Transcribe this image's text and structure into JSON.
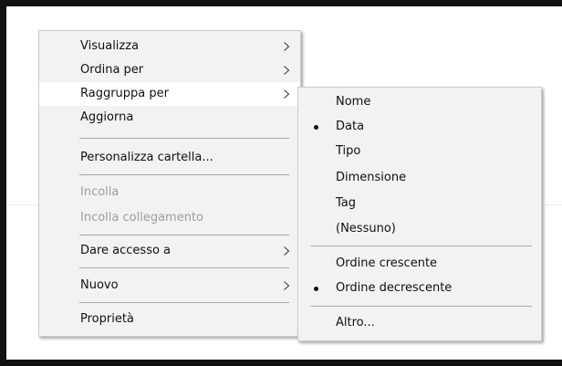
{
  "context_menu": {
    "items": [
      {
        "label": "Visualizza"
      },
      {
        "label": "Ordina per"
      },
      {
        "label": "Raggruppa per"
      },
      {
        "label": "Aggiorna"
      },
      {
        "label": "Personalizza cartella..."
      },
      {
        "label": "Incolla"
      },
      {
        "label": "Incolla collegamento"
      },
      {
        "label": "Dare accesso a"
      },
      {
        "label": "Nuovo"
      },
      {
        "label": "Proprietà"
      }
    ]
  },
  "submenu": {
    "items": [
      {
        "label": "Nome"
      },
      {
        "label": "Data"
      },
      {
        "label": "Tipo"
      },
      {
        "label": "Dimensione"
      },
      {
        "label": "Tag"
      },
      {
        "label": "(Nessuno)"
      },
      {
        "label": "Ordine crescente"
      },
      {
        "label": "Ordine decrescente"
      },
      {
        "label": "Altro..."
      }
    ]
  },
  "icons": {
    "submenu_arrow": "chevron-right-icon",
    "selected_marker": "bullet-icon"
  },
  "colors": {
    "menu_background": "#f2f2f2",
    "hover_highlight": "#ffffff",
    "disabled_text": "#9d9d9d",
    "frame": "#111111"
  }
}
